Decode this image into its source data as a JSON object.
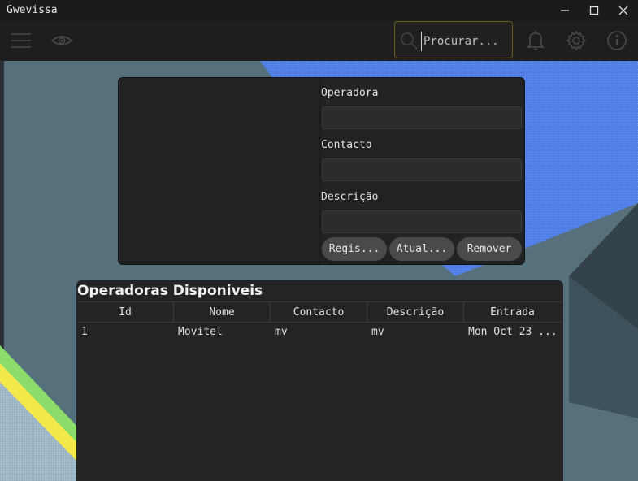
{
  "window": {
    "title": "Gwevissa"
  },
  "toolbar": {
    "menu_icon": "hamburger-menu-icon",
    "view_icon": "eye-icon",
    "search": {
      "placeholder": "Procurar...",
      "value": ""
    },
    "notification_icon": "bell-icon",
    "settings_icon": "gear-icon",
    "info_icon": "info-icon"
  },
  "form": {
    "operadora_label": "Operadora",
    "contacto_label": "Contacto",
    "descricao_label": "Descrição",
    "operadora_value": "",
    "contacto_value": "",
    "descricao_value": "",
    "register_label": "Regis...",
    "update_label": "Atual...",
    "remove_label": "Remover"
  },
  "table": {
    "title": "Operadoras Disponiveis",
    "columns": [
      "Id",
      "Nome",
      "Contacto",
      "Descrição",
      "Entrada"
    ],
    "rows": [
      [
        "1",
        "Movitel",
        "mv",
        "mv",
        "Mon Oct 23 ..."
      ]
    ]
  },
  "colors": {
    "background": "#1e1e1e",
    "panel": "#222222",
    "search_border": "#6b5e1a",
    "wallpaper_blue": "#4f7fe6",
    "wallpaper_slate": "#56707c"
  }
}
